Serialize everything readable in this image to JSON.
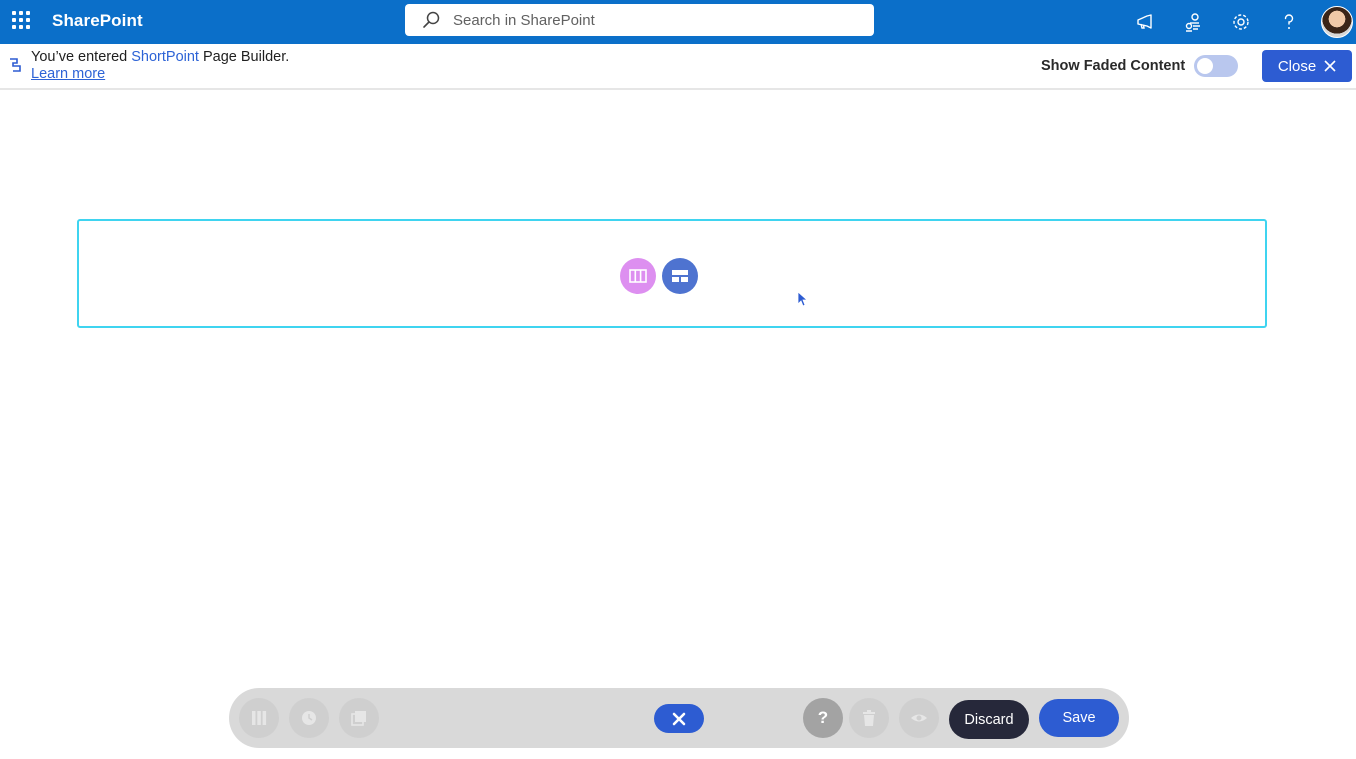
{
  "suitebar": {
    "brand": "SharePoint",
    "search_placeholder": "Search in SharePoint",
    "icons": [
      "waffle-icon",
      "megaphone-icon",
      "people-network-icon",
      "gear-icon",
      "help-icon",
      "avatar"
    ]
  },
  "notice": {
    "text_prefix": "You’ve entered ",
    "brand": "ShortPoint",
    "text_suffix": " Page Builder.",
    "link": "Learn more",
    "faded_label": "Show Faded Content",
    "faded_on": false,
    "close_label": "Close"
  },
  "section": {
    "buttons": [
      "columns-icon",
      "layout-icon"
    ]
  },
  "toolbar": {
    "discard_label": "Discard",
    "save_label": "Save",
    "help_label": "?"
  },
  "colors": {
    "suitebar": "#0b6fc9",
    "accent": "#2d5cd2",
    "section_border": "#3fd4f0",
    "columns_button": "#dd8ff0",
    "discard": "#26283a"
  }
}
